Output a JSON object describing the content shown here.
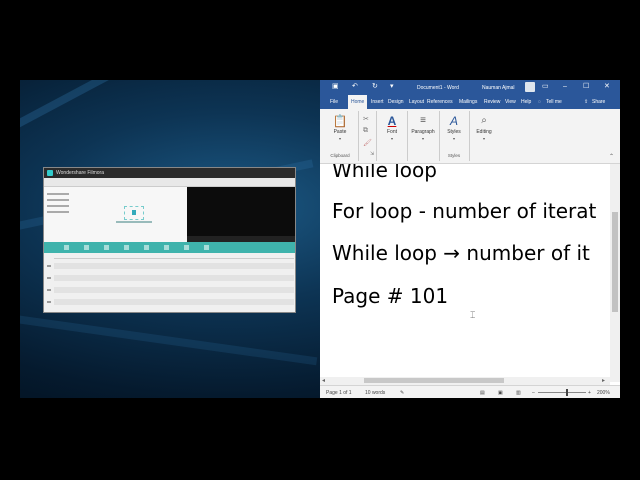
{
  "filmora": {
    "title": "Wondershare Filmora"
  },
  "word": {
    "title": "Document1 - Word",
    "user": "Nauman Ajmal",
    "quick_access": {
      "save_icon": "save-icon",
      "undo_icon": "undo-icon",
      "redo_icon": "redo-icon"
    },
    "window_controls": {
      "restore_icon": "ribbon-display-icon",
      "minimize": "–",
      "maximize": "☐",
      "close": "✕"
    },
    "tabs": [
      "File",
      "Home",
      "Insert",
      "Design",
      "Layout",
      "References",
      "Mailings",
      "Review",
      "View",
      "Help"
    ],
    "active_tab": "Home",
    "tell_me": "Tell me",
    "share": "Share",
    "ribbon": {
      "paste": "Paste",
      "font": "Font",
      "paragraph": "Paragraph",
      "styles": "Styles",
      "editing": "Editing",
      "clipboard": "Clipboard",
      "styles_group": "Styles"
    },
    "document_lines": [
      "While loop",
      "For loop - number of iterat",
      "While loop → number of it",
      "Page # 101"
    ],
    "status": {
      "page": "Page 1 of 1",
      "words": "10 words",
      "zoom": "200%"
    }
  }
}
